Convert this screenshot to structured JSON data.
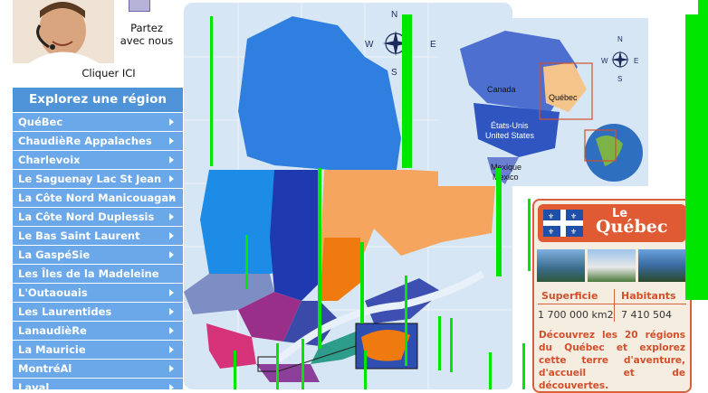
{
  "promo": {
    "text_line1": "Partez",
    "text_line2": "avec nous",
    "link": "Cliquer ICI"
  },
  "menu": {
    "title": "Explorez une région",
    "items": [
      {
        "label": "QuéBec",
        "arrow": true
      },
      {
        "label": "ChaudièRe Appalaches",
        "arrow": true
      },
      {
        "label": "Charlevoix",
        "arrow": true
      },
      {
        "label": "Le Saguenay Lac St Jean",
        "arrow": true
      },
      {
        "label": "La Côte Nord Manicouagan",
        "arrow": true
      },
      {
        "label": "La Côte Nord Duplessis",
        "arrow": true
      },
      {
        "label": "Le Bas Saint Laurent",
        "arrow": true
      },
      {
        "label": "La GaspéSie",
        "arrow": true
      },
      {
        "label": "Les Îles de la Madeleine",
        "arrow": false
      },
      {
        "label": "L'Outaouais",
        "arrow": true
      },
      {
        "label": "Les Laurentides",
        "arrow": true
      },
      {
        "label": "LanaudièRe",
        "arrow": true
      },
      {
        "label": "La Mauricie",
        "arrow": true
      },
      {
        "label": "MontréAl",
        "arrow": true
      },
      {
        "label": "Laval",
        "arrow": true
      }
    ]
  },
  "map": {
    "compass": [
      "N",
      "W",
      "E",
      "S"
    ]
  },
  "inset": {
    "labels": {
      "canada": "Canada",
      "quebec": "Québec",
      "usa_line1": "États-Unis",
      "usa_line2": "United States",
      "mexico": "Mexique",
      "mexico2": "Mexico"
    },
    "compass": [
      "N",
      "W",
      "E",
      "S"
    ]
  },
  "card": {
    "le": "Le",
    "name": "Québec",
    "header_superficie": "Superficie",
    "header_habitants": "Habitants",
    "superficie": "1 700 000 km2",
    "habitants": "7 410 504",
    "description": "Découvrez les 20 régions du Québec et explorez cette terre d'aventure, d'accueil et de découvertes."
  },
  "colors": {
    "menu_title_bg": "#4f93d8",
    "menu_item_bg": "#6aa8ea",
    "card_accent": "#e05b33",
    "map_bg": "#d7e6f4",
    "overlay_green": "#00e600"
  }
}
